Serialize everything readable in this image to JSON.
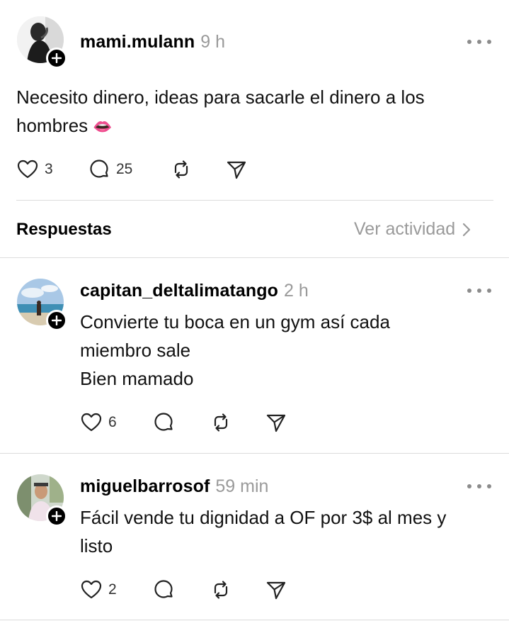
{
  "main_post": {
    "username": "mami.mulann",
    "time": "9 h",
    "text_line1": "Necesito dinero, ideas para sacarle el dinero a los",
    "text_line2": "hombres",
    "emoji": "👄",
    "likes": "3",
    "replies": "25"
  },
  "replies_header": {
    "title": "Respuestas",
    "view_activity": "Ver actividad"
  },
  "replies": [
    {
      "username": "capitan_deltalimatango",
      "time": "2 h",
      "lines": [
        "Convierte tu boca en un gym así cada",
        "miembro sale",
        "Bien mamado"
      ],
      "likes": "6"
    },
    {
      "username": "miguelbarrosof",
      "time": "59 min",
      "lines": [
        "Fácil vende tu dignidad a OF por 3$ al mes y",
        "listo"
      ],
      "likes": "2"
    }
  ],
  "icons": {
    "like": "heart-icon",
    "comment": "comment-icon",
    "repost": "repost-icon",
    "share": "send-icon",
    "more": "more-icon",
    "follow": "plus-icon"
  }
}
